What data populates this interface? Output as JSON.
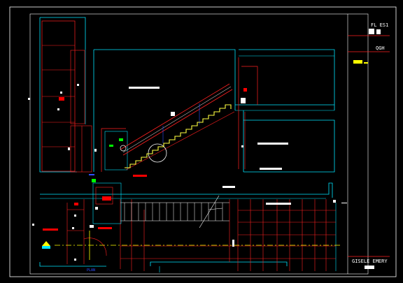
{
  "title_block": {
    "sheet_line1": "FL ES1",
    "sheet_line2": "QGH",
    "author": "GISELE EMERY"
  },
  "plan_label": "PLAN",
  "colors": {
    "background": "#000000",
    "frame": "#ffffff",
    "wall": "#00e5ff",
    "grid": "#ff2020",
    "stair": "#ffff40",
    "annotation": "#ff0000",
    "center_line": "#ffff00",
    "accent_green": "#00ff00",
    "accent_blue": "#3050ff"
  }
}
